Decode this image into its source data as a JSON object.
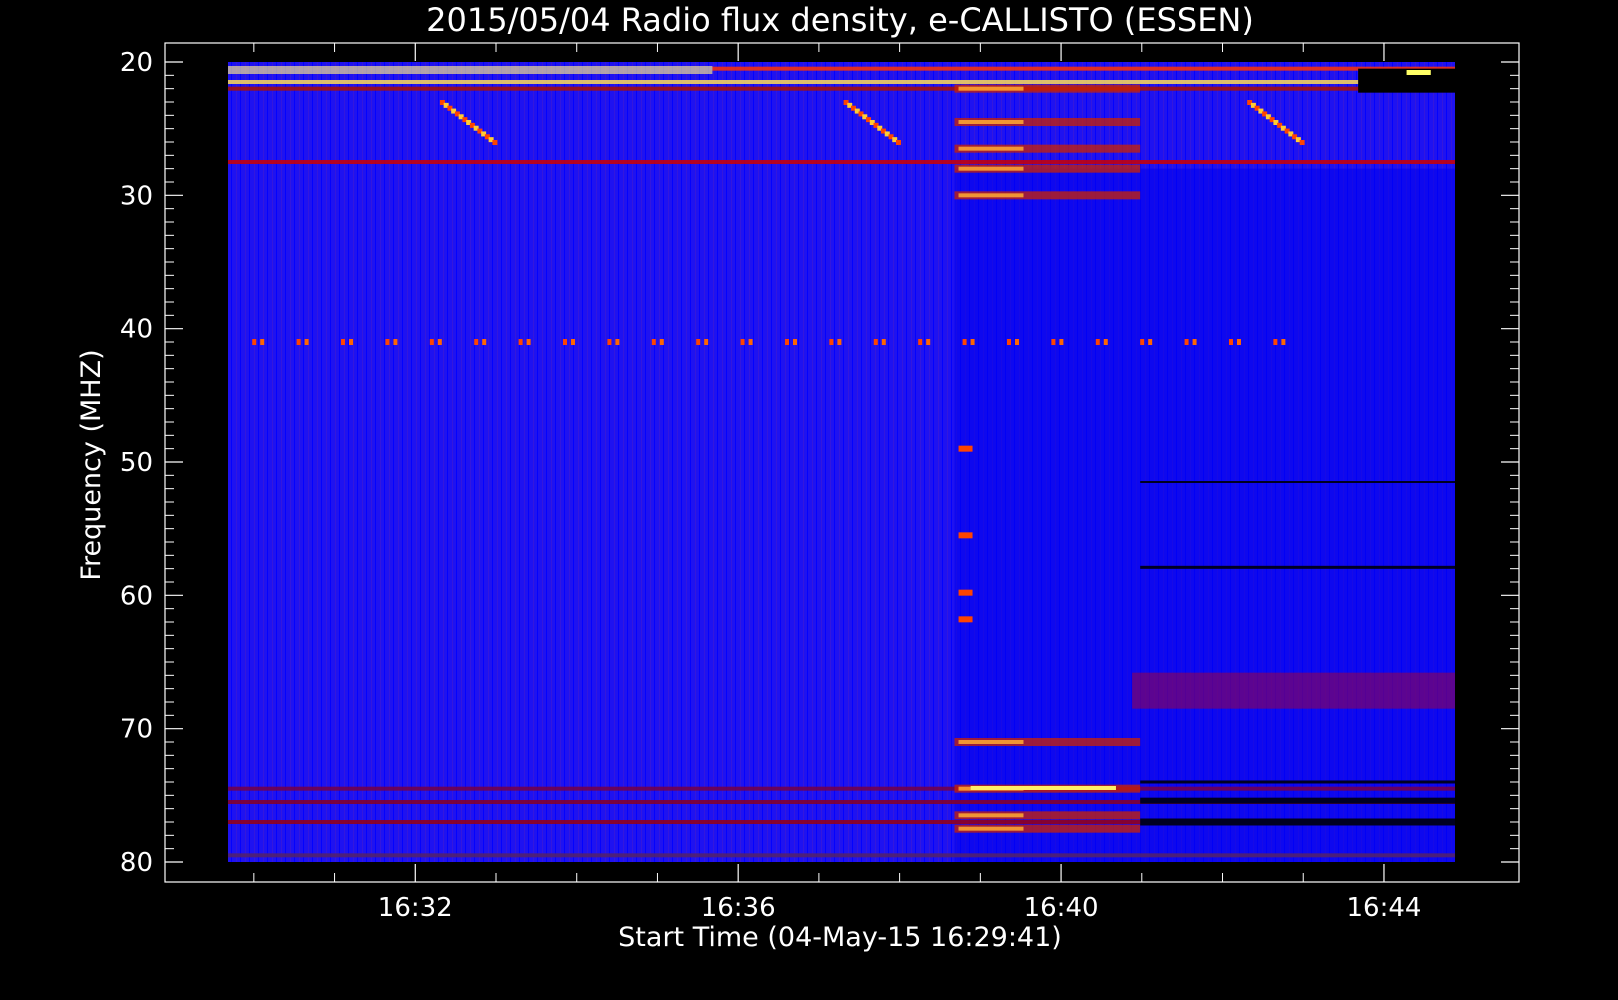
{
  "chart_data": {
    "type": "heatmap",
    "title": "2015/05/04  Radio flux density, e-CALLISTO (ESSEN)",
    "xlabel": "Start Time (04-May-15 16:29:41)",
    "ylabel": "Frequency (MHZ)",
    "x_units": "minutes since 16:29:41 UT",
    "x_range_minutes": [
      0,
      15.2
    ],
    "ylim": [
      20,
      80
    ],
    "y_inverted": true,
    "y_ticks": [
      "20",
      "30",
      "40",
      "50",
      "60",
      "70",
      "80"
    ],
    "x_ticks": [
      {
        "label": "16:32",
        "minute": 2.32
      },
      {
        "label": "16:36",
        "minute": 6.32
      },
      {
        "label": "16:40",
        "minute": 10.32
      },
      {
        "label": "16:44",
        "minute": 14.32
      }
    ],
    "colormap": [
      "#000000",
      "#0000ff",
      "#ff0000",
      "#ffff66"
    ],
    "background_intensity": "blue",
    "features": {
      "sweeps": [
        {
          "start_minute": 2.65,
          "end_minute": 3.3,
          "freq_start_mhz": 23.0,
          "freq_end_mhz": 26.0
        },
        {
          "start_minute": 7.65,
          "end_minute": 8.3,
          "freq_start_mhz": 23.0,
          "freq_end_mhz": 26.0
        },
        {
          "start_minute": 12.65,
          "end_minute": 13.3,
          "freq_start_mhz": 23.0,
          "freq_end_mhz": 26.0
        }
      ],
      "interference_bands_mhz": [
        20.5,
        21.5,
        22.0,
        27.5,
        41.0,
        74.5,
        75.5,
        77.0,
        79.5
      ],
      "dotted_line_mhz": 41.0,
      "burst_window_minutes": [
        9.0,
        11.3
      ],
      "burst_band_freqs_mhz": [
        22.0,
        24.5,
        26.5,
        28.0,
        30.0,
        71.0,
        74.5,
        76.5,
        77.5
      ]
    }
  }
}
